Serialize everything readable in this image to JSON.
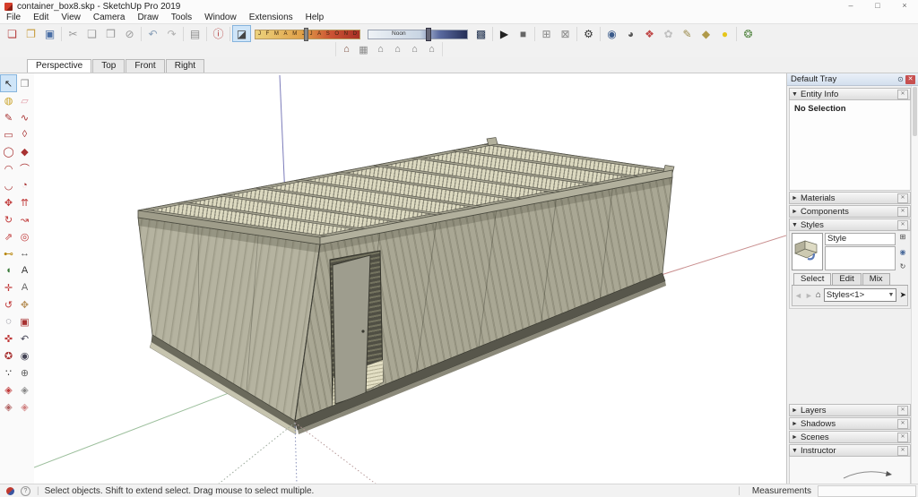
{
  "theme": {
    "accent": "#cfe5f8",
    "sketchup-red": "#c0392b",
    "viewport-bg": "#ffffff",
    "wall-color": "#a9a794",
    "roof-color": "#dbd8bf",
    "axis-red": "#c98f8f",
    "axis-green": "#9cbf9c",
    "axis-blue": "#7c7cba"
  },
  "window": {
    "title": "container_box8.skp - SketchUp Pro 2019",
    "controls": {
      "minimize": "–",
      "maximize": "□",
      "close": "×"
    }
  },
  "menu": {
    "items": [
      {
        "name": "file",
        "label": "File"
      },
      {
        "name": "edit",
        "label": "Edit"
      },
      {
        "name": "view",
        "label": "View"
      },
      {
        "name": "camera",
        "label": "Camera"
      },
      {
        "name": "draw",
        "label": "Draw"
      },
      {
        "name": "tools",
        "label": "Tools"
      },
      {
        "name": "window",
        "label": "Window"
      },
      {
        "name": "extensions",
        "label": "Extensions"
      },
      {
        "name": "help",
        "label": "Help"
      }
    ]
  },
  "toolbar": {
    "left_icons": [
      {
        "name": "new",
        "glyph": "❏",
        "color": "#b43c3c"
      },
      {
        "name": "open",
        "glyph": "❐",
        "color": "#c79a3a"
      },
      {
        "name": "save",
        "glyph": "▣",
        "color": "#4a6fa5"
      },
      {
        "kind": "sep"
      },
      {
        "name": "cut",
        "glyph": "✂",
        "color": "#9a9a9a"
      },
      {
        "name": "copy",
        "glyph": "❑",
        "color": "#9a9a9a"
      },
      {
        "name": "paste",
        "glyph": "❒",
        "color": "#9a9a9a"
      },
      {
        "name": "erase",
        "glyph": "⊘",
        "color": "#9a9a9a"
      },
      {
        "kind": "sep"
      },
      {
        "name": "undo",
        "glyph": "↶",
        "color": "#8aa0b8"
      },
      {
        "name": "redo",
        "glyph": "↷",
        "color": "#b0b0b0"
      },
      {
        "kind": "sep"
      },
      {
        "name": "print",
        "glyph": "▤",
        "color": "#8a8a8a"
      },
      {
        "kind": "sep"
      },
      {
        "name": "model-info",
        "glyph": "ⓘ",
        "color": "#b43c3c"
      },
      {
        "kind": "sep"
      },
      {
        "name": "shadows-toggle",
        "glyph": "◪",
        "color": "#444444",
        "state": "active"
      }
    ],
    "month_slider": {
      "labels": [
        "J",
        "F",
        "M",
        "A",
        "M",
        "J",
        "J",
        "A",
        "S",
        "O",
        "N",
        "D"
      ]
    },
    "time_slider": {
      "label": "Noon"
    },
    "right_icons": [
      {
        "name": "render-engine",
        "glyph": "▩",
        "color": "#223350"
      },
      {
        "kind": "sep"
      },
      {
        "name": "render-play",
        "glyph": "▶",
        "color": "#222222"
      },
      {
        "name": "render-stop",
        "glyph": "■",
        "color": "#666666"
      },
      {
        "kind": "sep"
      },
      {
        "name": "add-scene",
        "glyph": "⊞",
        "color": "#888888"
      },
      {
        "name": "remove-scene",
        "glyph": "⊠",
        "color": "#888888"
      },
      {
        "kind": "sep"
      },
      {
        "name": "render-settings",
        "glyph": "⚙",
        "color": "#333333"
      },
      {
        "kind": "sep"
      },
      {
        "name": "interactive-render",
        "glyph": "◉",
        "color": "#3a5a8a"
      },
      {
        "name": "render-sphere",
        "glyph": "◕",
        "color": "#555555"
      },
      {
        "name": "material-palette",
        "glyph": "❖",
        "color": "#c04848"
      },
      {
        "name": "batch-render",
        "glyph": "✿",
        "color": "#c0c0c0"
      },
      {
        "name": "tools-pencil",
        "glyph": "✎",
        "color": "#9a8a4a"
      },
      {
        "name": "asset-package",
        "glyph": "◆",
        "color": "#b09a4a"
      },
      {
        "name": "light-bulb",
        "glyph": "●",
        "color": "#e6c619"
      },
      {
        "kind": "sep"
      },
      {
        "name": "extension-tool",
        "glyph": "❂",
        "color": "#5a8a4a"
      }
    ]
  },
  "views_toolbar": {
    "icons": [
      {
        "name": "view-iso",
        "glyph": "⌂",
        "color": "#7a4a3a"
      },
      {
        "name": "view-top",
        "glyph": "▦",
        "color": "#8a8a8a"
      },
      {
        "name": "view-front",
        "glyph": "⌂",
        "color": "#777777"
      },
      {
        "name": "view-right",
        "glyph": "⌂",
        "color": "#777777"
      },
      {
        "name": "view-back",
        "glyph": "⌂",
        "color": "#777777"
      },
      {
        "name": "view-left",
        "glyph": "⌂",
        "color": "#777777"
      }
    ]
  },
  "scene_tabs": {
    "tabs": [
      {
        "name": "perspective",
        "label": "Perspective",
        "state": "active"
      },
      {
        "name": "top",
        "label": "Top"
      },
      {
        "name": "front",
        "label": "Front"
      },
      {
        "name": "right",
        "label": "Right"
      }
    ]
  },
  "tool_palette": {
    "tools": [
      {
        "name": "select",
        "glyph": "↖",
        "color": "#222222",
        "state": "active"
      },
      {
        "name": "make-component",
        "glyph": "❒",
        "color": "#8a8a8a"
      },
      {
        "name": "paint-bucket",
        "glyph": "◍",
        "color": "#c9a227"
      },
      {
        "name": "eraser",
        "glyph": "▱",
        "color": "#e09aa5"
      },
      {
        "name": "line",
        "glyph": "✎",
        "color": "#a83232"
      },
      {
        "name": "freehand",
        "glyph": "∿",
        "color": "#a83232"
      },
      {
        "name": "rectangle",
        "glyph": "▭",
        "color": "#a83232"
      },
      {
        "name": "rotated-rectangle",
        "glyph": "◊",
        "color": "#a83232"
      },
      {
        "name": "circle",
        "glyph": "◯",
        "color": "#a83232"
      },
      {
        "name": "polygon",
        "glyph": "◆",
        "color": "#a83232"
      },
      {
        "name": "arc",
        "glyph": "◠",
        "color": "#a83232"
      },
      {
        "name": "two-point-arc",
        "glyph": "⌒",
        "color": "#a83232"
      },
      {
        "name": "three-point-arc",
        "glyph": "◡",
        "color": "#a83232"
      },
      {
        "name": "pie",
        "glyph": "◔",
        "color": "#a83232"
      },
      {
        "name": "move",
        "glyph": "✥",
        "color": "#c03a3a"
      },
      {
        "name": "push-pull",
        "glyph": "⇈",
        "color": "#c03a3a"
      },
      {
        "name": "rotate",
        "glyph": "↻",
        "color": "#c03a3a"
      },
      {
        "name": "follow-me",
        "glyph": "↝",
        "color": "#c03a3a"
      },
      {
        "name": "scale",
        "glyph": "⇗",
        "color": "#c03a3a"
      },
      {
        "name": "offset",
        "glyph": "◎",
        "color": "#c03a3a"
      },
      {
        "name": "tape-measure",
        "glyph": "⊷",
        "color": "#b8860b"
      },
      {
        "name": "dimensions",
        "glyph": "↔",
        "color": "#555555"
      },
      {
        "name": "protractor",
        "glyph": "◖",
        "color": "#3a7a3a"
      },
      {
        "name": "text",
        "glyph": "A",
        "color": "#333333"
      },
      {
        "name": "axes",
        "glyph": "✛",
        "color": "#c03a3a"
      },
      {
        "name": "three-d-text",
        "glyph": "A",
        "color": "#666666"
      },
      {
        "name": "orbit",
        "glyph": "↺",
        "color": "#c03a3a"
      },
      {
        "name": "pan",
        "glyph": "✥",
        "color": "#b8915a"
      },
      {
        "name": "zoom",
        "glyph": "◌",
        "color": "#444455"
      },
      {
        "name": "zoom-window",
        "glyph": "▣",
        "color": "#a83232"
      },
      {
        "name": "zoom-extents",
        "glyph": "✜",
        "color": "#c03a3a"
      },
      {
        "name": "zoom-previous",
        "glyph": "↶",
        "color": "#444455"
      },
      {
        "name": "position-camera",
        "glyph": "✪",
        "color": "#a83232"
      },
      {
        "name": "look-around",
        "glyph": "◉",
        "color": "#444455"
      },
      {
        "name": "walk",
        "glyph": "∵",
        "color": "#333333"
      },
      {
        "name": "center-view",
        "glyph": "⊕",
        "color": "#666666"
      },
      {
        "name": "section-plane",
        "glyph": "◈",
        "color": "#c03a3a"
      },
      {
        "name": "section-display",
        "glyph": "◈",
        "color": "#888888"
      },
      {
        "name": "section-fill",
        "glyph": "◈",
        "color": "#b06060"
      },
      {
        "name": "section-outline",
        "glyph": "◈",
        "color": "#d08080"
      }
    ]
  },
  "tray": {
    "title": "Default Tray",
    "entity_info": {
      "label": "Entity Info",
      "content": "No Selection"
    },
    "materials": {
      "label": "Materials"
    },
    "components": {
      "label": "Components"
    },
    "styles": {
      "label": "Styles",
      "name_value": "Style",
      "tabs": {
        "select": "Select",
        "edit": "Edit",
        "mix": "Mix"
      },
      "dropdown_value": "Styles<1>"
    },
    "layers": {
      "label": "Layers"
    },
    "shadows": {
      "label": "Shadows"
    },
    "scenes": {
      "label": "Scenes"
    },
    "instructor": {
      "label": "Instructor"
    }
  },
  "status_bar": {
    "message": "Select objects. Shift to extend select. Drag mouse to select multiple.",
    "measurements_label": "Measurements",
    "measurements_value": ""
  }
}
